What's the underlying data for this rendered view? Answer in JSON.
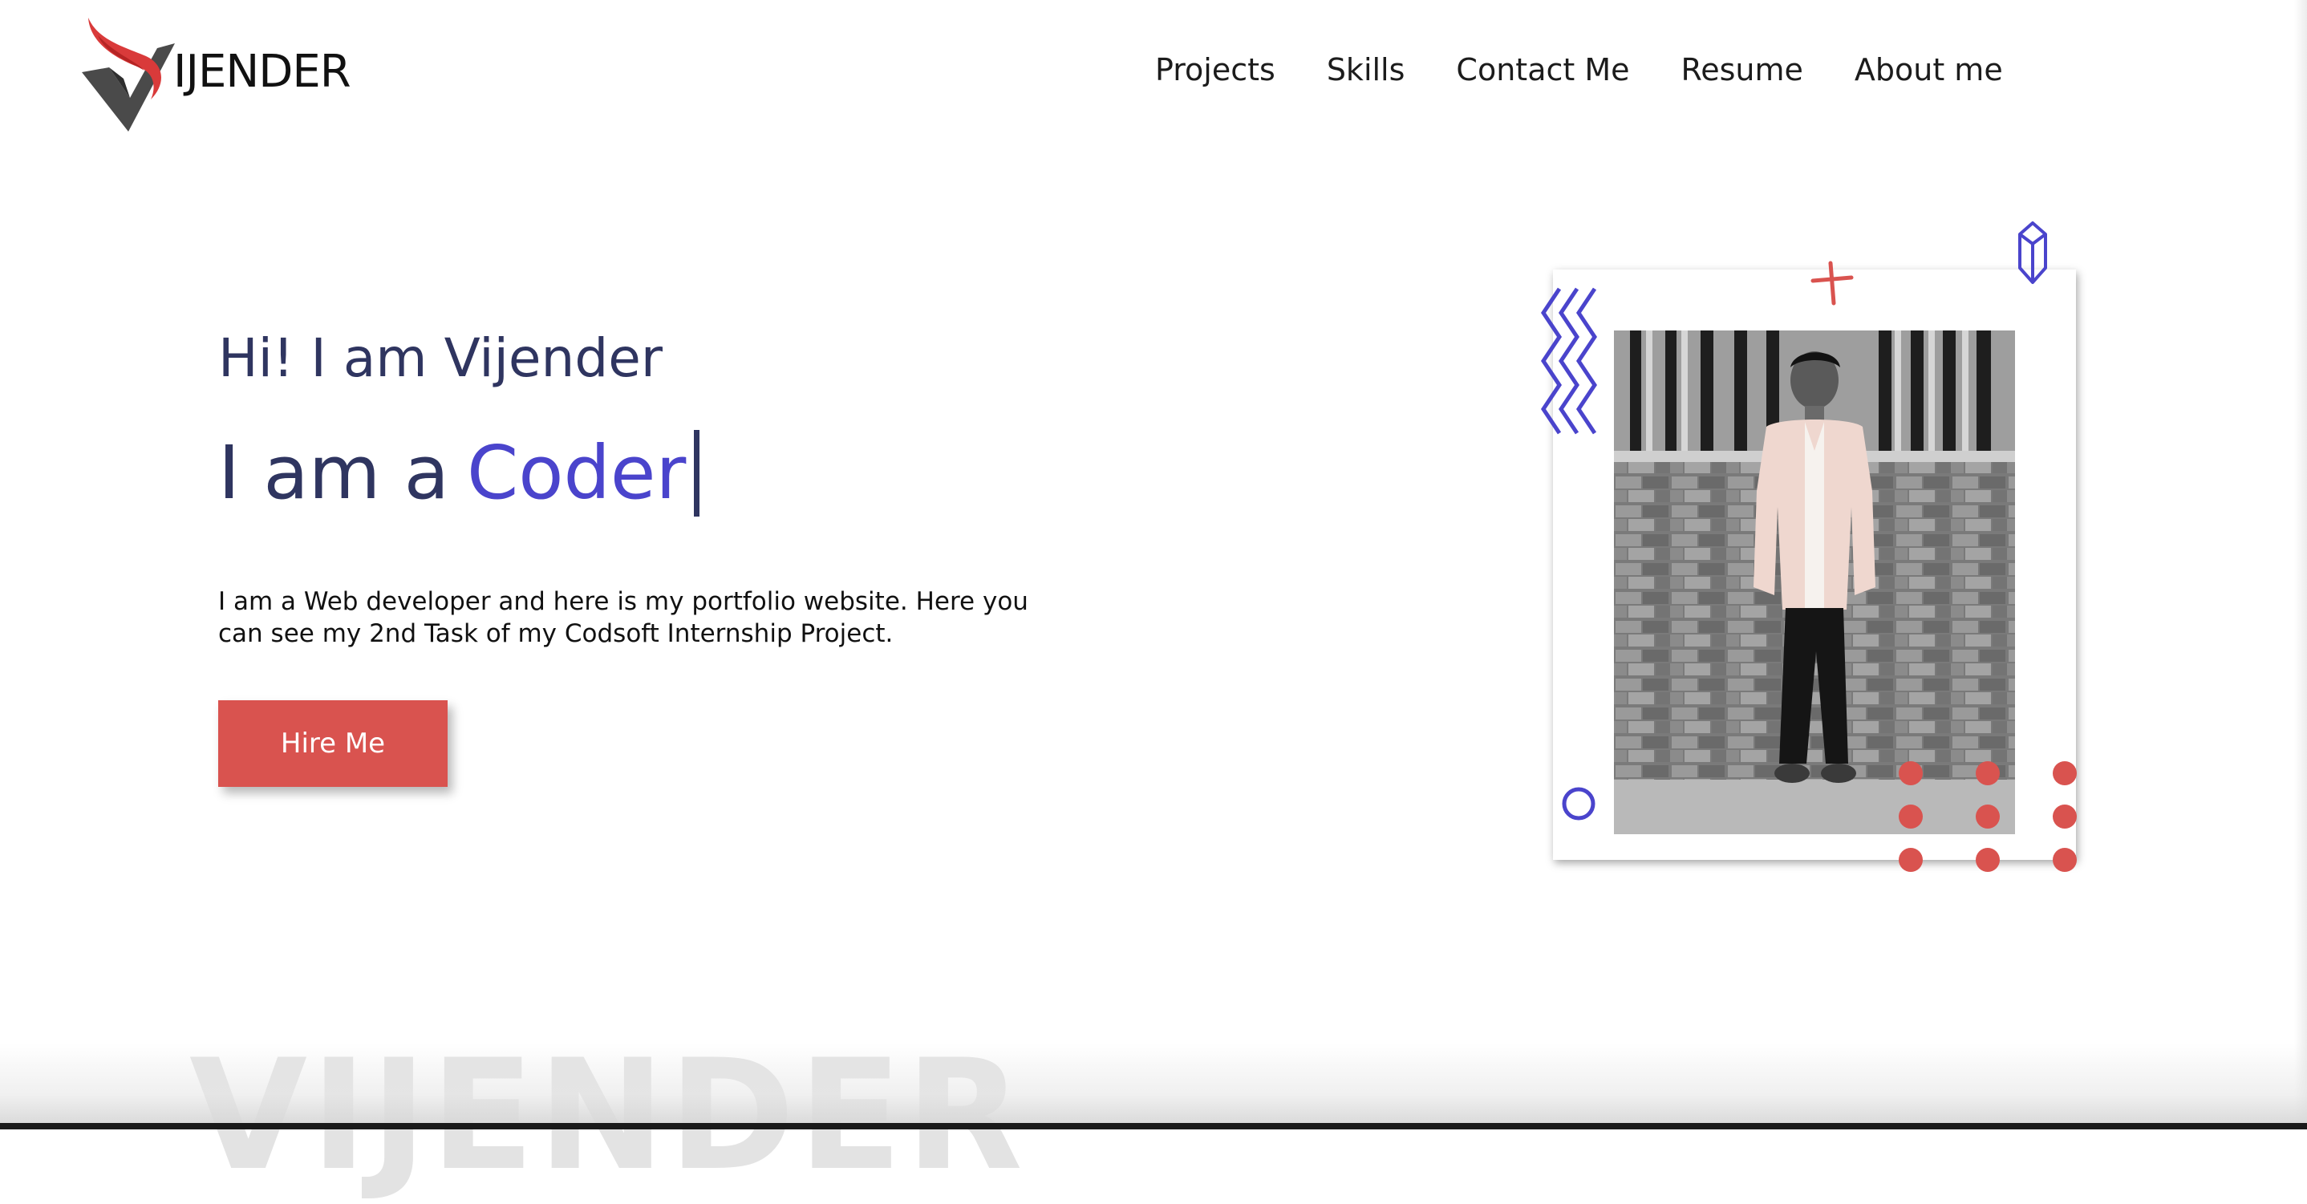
{
  "header": {
    "logo_text": "IJENDER",
    "nav": [
      "Projects",
      "Skills",
      "Contact Me",
      "Resume",
      "About me"
    ]
  },
  "hero": {
    "greeting": "Hi! I am Vijender",
    "role_prefix": "I am a",
    "role_word": "Coder",
    "intro": "I am a Web developer and here is my portfolio website. Here you can see my 2nd Task of my Codsoft Internship Project.",
    "cta_label": "Hire Me"
  },
  "watermark": "VIJENDER",
  "colors": {
    "text_dark": "#2f3560",
    "accent_blue": "#4a44cc",
    "accent_red": "#d9534f",
    "logo_red": "#d93a3a",
    "logo_gray": "#4a4a4a"
  }
}
